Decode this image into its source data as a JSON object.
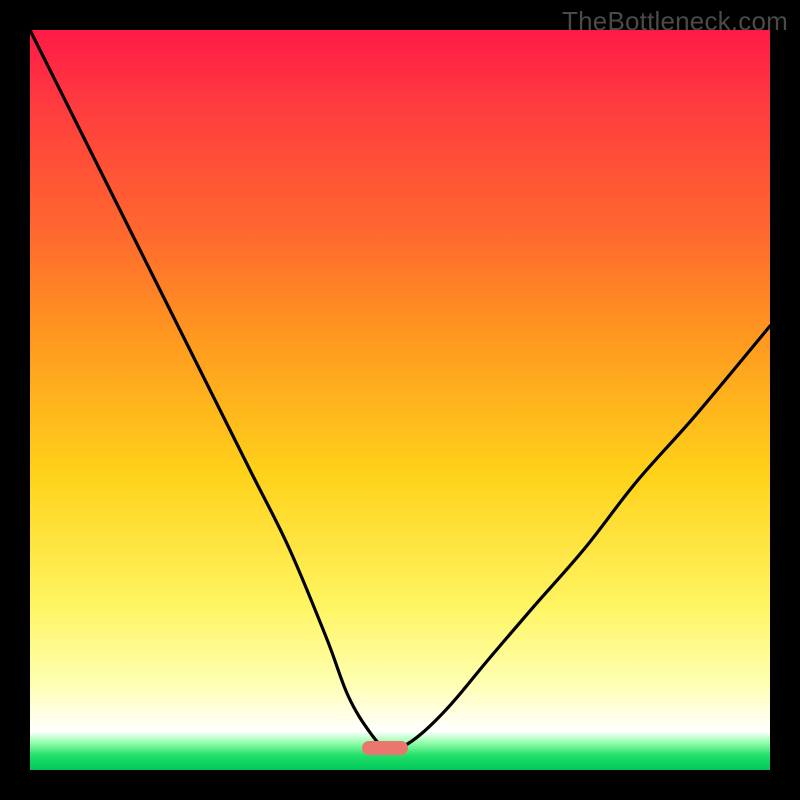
{
  "watermark": "TheBottleneck.com",
  "colors": {
    "page_bg": "#000000",
    "watermark_text": "#4a4a4a",
    "curve_stroke": "#000000",
    "marker_fill": "#e9776f",
    "gradient_stops": [
      "#ff1a47",
      "#ff3b3f",
      "#ff6a2e",
      "#ff9a1f",
      "#ffd21a",
      "#fff563",
      "#ffffb0",
      "#ffffff",
      "#9dffb0",
      "#23e06a",
      "#00c85a"
    ]
  },
  "chart_data": {
    "type": "line",
    "title": "",
    "xlabel": "",
    "ylabel": "",
    "xlim": [
      0,
      100
    ],
    "ylim": [
      0,
      100
    ],
    "grid": false,
    "legend": false,
    "watermark": "TheBottleneck.com",
    "notes": "Smooth valley curve over a vertical heat gradient. No axis ticks or numeric labels are visible; x/y are normalized 0–100. Higher y = higher on the image. Minimum sits near x≈48 at the green band (y≈3); left arm starts at top-left corner (y≈100) and right arm exits at roughly 60% height on the right edge.",
    "series": [
      {
        "name": "curve",
        "x": [
          0,
          5,
          10,
          15,
          20,
          25,
          30,
          35,
          40,
          43,
          46,
          48,
          50,
          53,
          57,
          62,
          68,
          75,
          82,
          90,
          100
        ],
        "y": [
          100,
          90,
          80,
          70,
          60,
          50,
          40,
          30,
          18,
          10,
          5,
          3,
          3,
          5,
          9,
          15,
          22,
          30,
          39,
          48,
          60
        ]
      }
    ],
    "marker": {
      "x": 48,
      "y": 3,
      "shape": "pill",
      "color": "#e9776f"
    }
  }
}
